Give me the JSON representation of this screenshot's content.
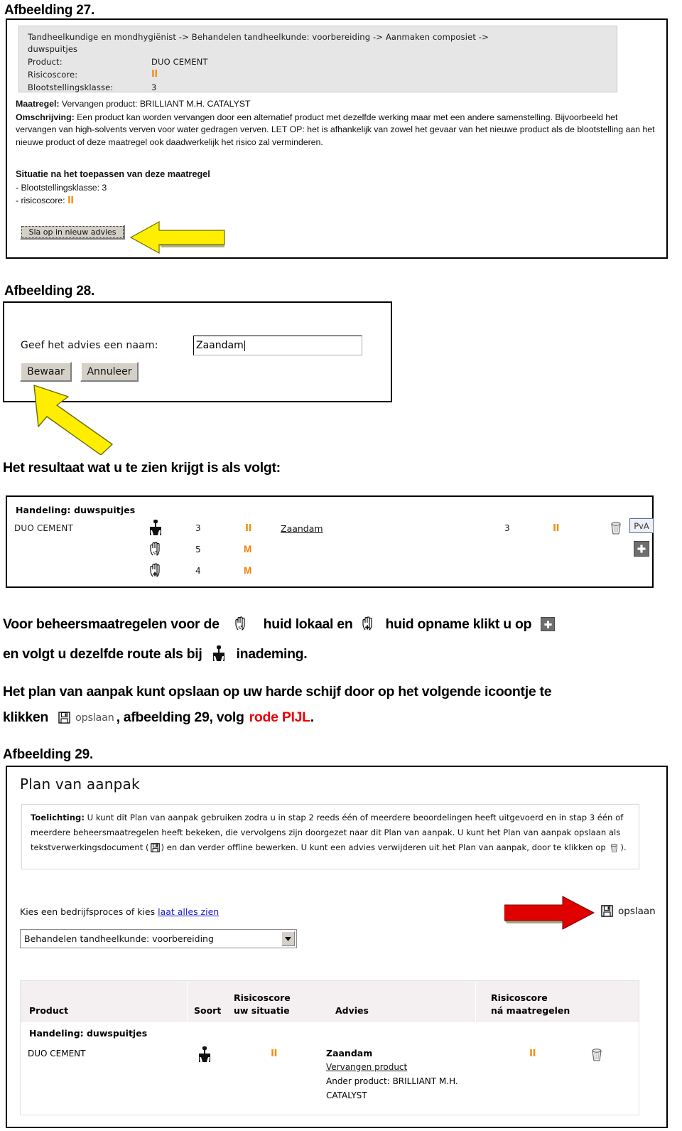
{
  "figure27": {
    "caption": "Afbeelding 27.",
    "panel": {
      "breadcrumb_line1": "Tandheelkundige en mondhygiënist -> Behandelen tandheelkunde: voorbereiding -> Aanmaken composiet ->",
      "breadcrumb_line2": "duwspuitjes",
      "rows": [
        {
          "label": "Product:",
          "value": "DUO CEMENT",
          "type": "text"
        },
        {
          "label": "Risicoscore:",
          "value": "II",
          "type": "risk"
        },
        {
          "label": "Blootstellingsklasse:",
          "value": "3",
          "type": "text"
        }
      ]
    },
    "maatregel_label": "Maatregel:",
    "maatregel_value": " Vervangen product: BRILLIANT M.H. CATALYST",
    "omschrijving_label": "Omschrijving:",
    "omschrijving_value": " Een product kan worden vervangen door een alternatief product met dezelfde werking maar met een andere samenstelling. Bijvoorbeeld het vervangen van high-solvents verven voor water gedragen verven. LET OP: het is afhankelijk van zowel het gevaar van het nieuwe product als de blootstelling aan het nieuwe product of deze maatregel ook daadwerkelijk het risico zal verminderen.",
    "situatie_heading": "Situatie na het toepassen van deze maatregel",
    "situatie_row1": "-  Blootstellingsklasse:   3",
    "situatie_row2_label": "-  risicoscore:",
    "situatie_row2_value": "II",
    "save_button": "Sla op in nieuw advies",
    "arrow_name": "yellow-arrow-left"
  },
  "figure28": {
    "caption": "Afbeelding 28.",
    "name_label": "Geef het advies een naam:",
    "name_value": "Zaandam",
    "save_button": "Bewaar",
    "cancel_button": "Annuleer",
    "arrow_name": "yellow-arrow-diagonal"
  },
  "result_intro": "Het resultaat wat u te zien krijgt is als volgt:",
  "result_panel": {
    "heading": "Handeling: duwspuitjes",
    "product": "DUO CEMENT",
    "rows": [
      {
        "icon": "lungs-icon",
        "exposure": "3",
        "score": "II",
        "score_color": "#ef9116"
      },
      {
        "icon": "hand-local-icon",
        "exposure": "5",
        "score": "M",
        "score_color": "#f08000"
      },
      {
        "icon": "hand-uptake-icon",
        "exposure": "4",
        "score": "M",
        "score_color": "#f08000"
      }
    ],
    "advice_link": "Zaandam",
    "after_exposure": "3",
    "after_score": "II",
    "trash_icon": "trash-icon",
    "pva_button": "PvA",
    "plus_button": "plus-icon"
  },
  "paragraph1": {
    "part1": "Voor beheersmaatregelen voor de",
    "icon1": "hand-local-icon",
    "part2": "huid lokaal en",
    "icon2": "hand-uptake-icon",
    "part3": "huid opname klikt u op",
    "icon3": "plus-icon",
    "part4": "en volgt u dezelfde route als bij",
    "icon4": "lungs-icon",
    "part5": "inademing."
  },
  "paragraph2": {
    "part1": "Het plan van aanpak kunt opslaan op uw harde schijf door op het volgende icoontje te",
    "part2": "klikken",
    "icon": "floppy-save-icon",
    "icon_label": "opslaan",
    "part3": ", afbeelding 29, volg",
    "red_text": "rode PIJL",
    "part4": "."
  },
  "figure29": {
    "caption": "Afbeelding 29.",
    "title": "Plan van aanpak",
    "toelichting_label": "Toelichting:",
    "toelichting_text_a": " U kunt dit Plan van aanpak gebruiken zodra u in stap 2 reeds één of meerdere beoordelingen heeft uitgevoerd en in stap 3 één of meerdere beheersmaatregelen heeft bekeken, die vervolgens zijn doorgezet naar dit Plan van aanpak. U kunt het Plan van aanpak opslaan als tekstverwerkingsdocument (",
    "toelichting_text_b": ") en dan verder offline bewerken. U kunt een advies verwijderen uit het Plan van aanpak, door te klikken op ",
    "toelichting_text_c": ").",
    "choose_label": "Kies een bedrijfsproces of kies",
    "choose_link": "laat alles zien",
    "dropdown_value": "Behandelen tandheelkunde: voorbereiding",
    "save_icon": "floppy-save-icon",
    "save_label": "opslaan",
    "arrow_name": "red-arrow-right",
    "table": {
      "headers": [
        "Product",
        "Soort",
        "Risicoscore\nuw situatie",
        "Advies",
        "Risicoscore\nná maatregelen",
        ""
      ],
      "header_product": "Product",
      "header_soort": "Soort",
      "header_risico_uw_l1": "Risicoscore",
      "header_risico_uw_l2": "uw situatie",
      "header_advies": "Advies",
      "header_risico_na_l1": "Risicoscore",
      "header_risico_na_l2": "ná maatregelen",
      "group_row": "Handeling: duwspuitjes",
      "row": {
        "product": "DUO CEMENT",
        "soort_icon": "lungs-icon",
        "risico_uw": "II",
        "advies_title": "Zaandam",
        "advies_link": "Vervangen product",
        "advies_line2": "Ander product: BRILLIANT M.H.",
        "advies_line3": "CATALYST",
        "risico_na": "II",
        "delete_icon": "trash-icon"
      }
    }
  },
  "colors": {
    "risk_orange": "#ef9116",
    "red_arrow": "#e00000",
    "yellow_arrow": "#ffee00",
    "panel_grey": "#e6e6e6"
  }
}
